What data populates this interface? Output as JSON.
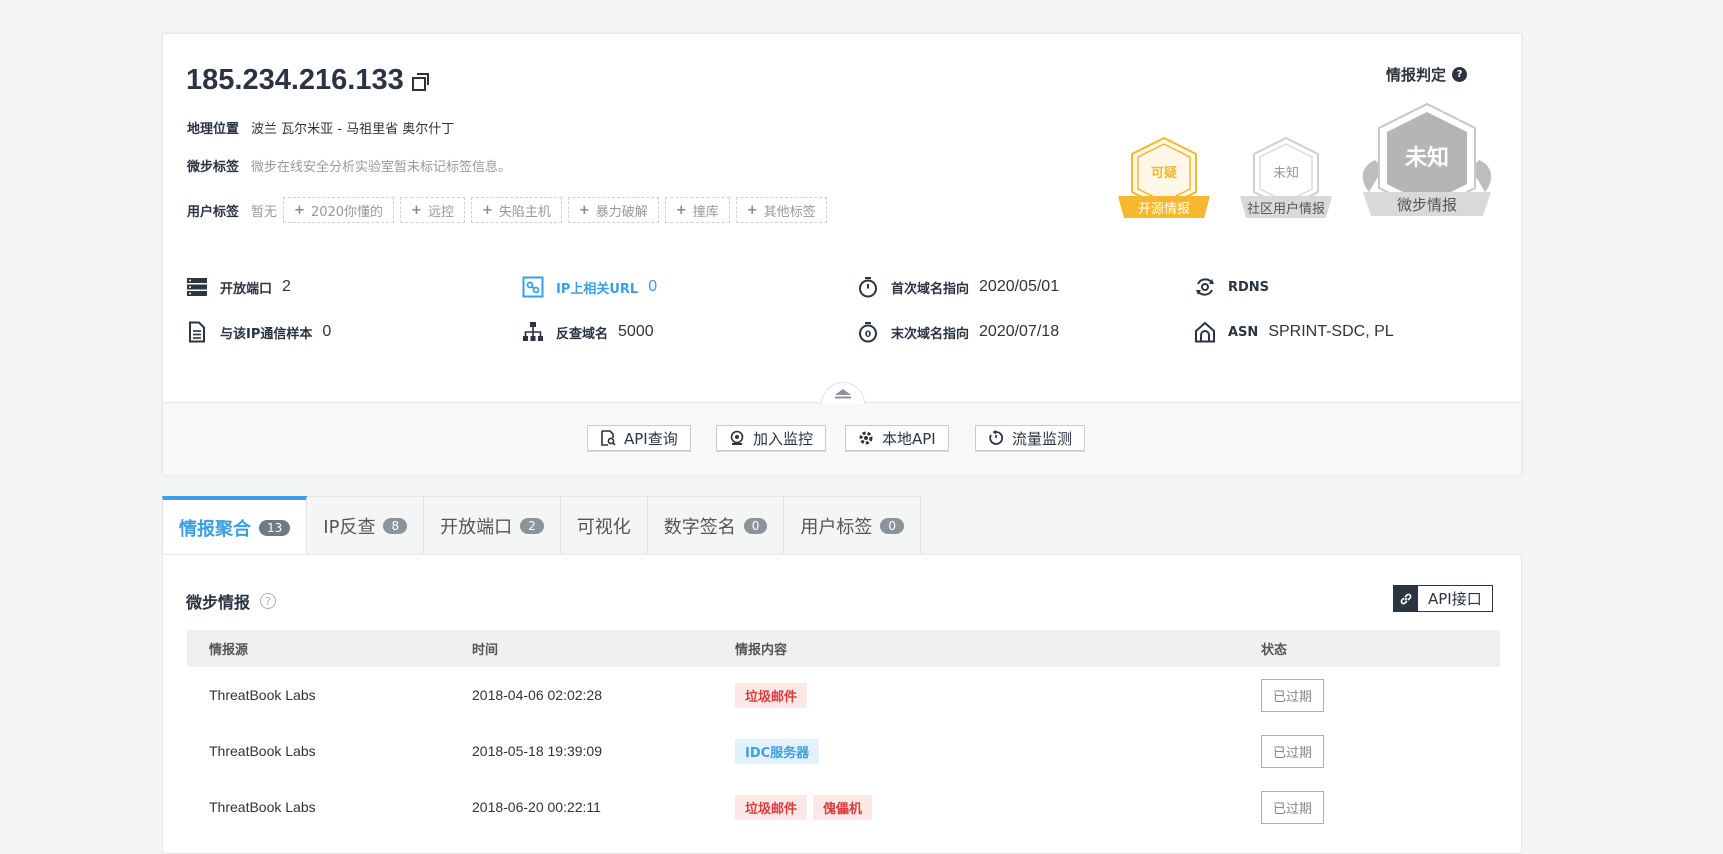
{
  "ip": "185.234.216.133",
  "location": {
    "label": "地理位置",
    "value": "波兰 瓦尔米亚 - 马祖里省 奥尔什丁"
  },
  "wb_tags": {
    "label": "微步标签",
    "value": "微步在线安全分析实验室暂未标记标签信息。"
  },
  "user_tags": {
    "label": "用户标签",
    "none": "暂无",
    "add": [
      "2020你懂的",
      "远控",
      "失陷主机",
      "暴力破解",
      "撞库",
      "其他标签"
    ]
  },
  "stats": {
    "open_ports": {
      "label": "开放端口",
      "value": "2"
    },
    "ip_url": {
      "label": "IP上相关URL",
      "value": "0"
    },
    "first_domain": {
      "label": "首次域名指向",
      "value": "2020/05/01"
    },
    "rdns": {
      "label": "RDNS",
      "value": ""
    },
    "samples": {
      "label": "与该IP通信样本",
      "value": "0"
    },
    "reverse_domain": {
      "label": "反查域名",
      "value": "5000"
    },
    "last_domain": {
      "label": "末次域名指向",
      "value": "2020/07/18"
    },
    "asn": {
      "label": "ASN",
      "value": "SPRINT-SDC, PL"
    }
  },
  "verdict": {
    "title": "情报判定",
    "open_source": {
      "status": "可疑",
      "label": "开源情报"
    },
    "community": {
      "status": "未知",
      "label": "社区用户情报"
    },
    "threatbook": {
      "status": "未知",
      "label": "微步情报"
    }
  },
  "toolbar": [
    "API查询",
    "加入监控",
    "本地API",
    "流量监测"
  ],
  "tabs": [
    {
      "label": "情报聚合",
      "count": "13"
    },
    {
      "label": "IP反查",
      "count": "8"
    },
    {
      "label": "开放端口",
      "count": "2"
    },
    {
      "label": "可视化",
      "count": ""
    },
    {
      "label": "数字签名",
      "count": "0"
    },
    {
      "label": "用户标签",
      "count": "0"
    }
  ],
  "panel": {
    "title": "微步情报",
    "api_button": "API接口",
    "columns": [
      "情报源",
      "时间",
      "情报内容",
      "状态"
    ],
    "rows": [
      {
        "source": "ThreatBook Labs",
        "time": "2018-04-06 02:02:28",
        "tags": [
          "垃圾邮件"
        ],
        "status": "已过期"
      },
      {
        "source": "ThreatBook Labs",
        "time": "2018-05-18 19:39:09",
        "tags": [
          "IDC服务器"
        ],
        "status": "已过期"
      },
      {
        "source": "ThreatBook Labs",
        "time": "2018-06-20 00:22:11",
        "tags": [
          "垃圾邮件",
          "傀儡机"
        ],
        "status": "已过期"
      }
    ]
  },
  "colors": {
    "accent": "#3aa0e6",
    "suspicious": "#f7b82f",
    "unknown": "#b5b5b5",
    "danger": "#e03b3b"
  }
}
